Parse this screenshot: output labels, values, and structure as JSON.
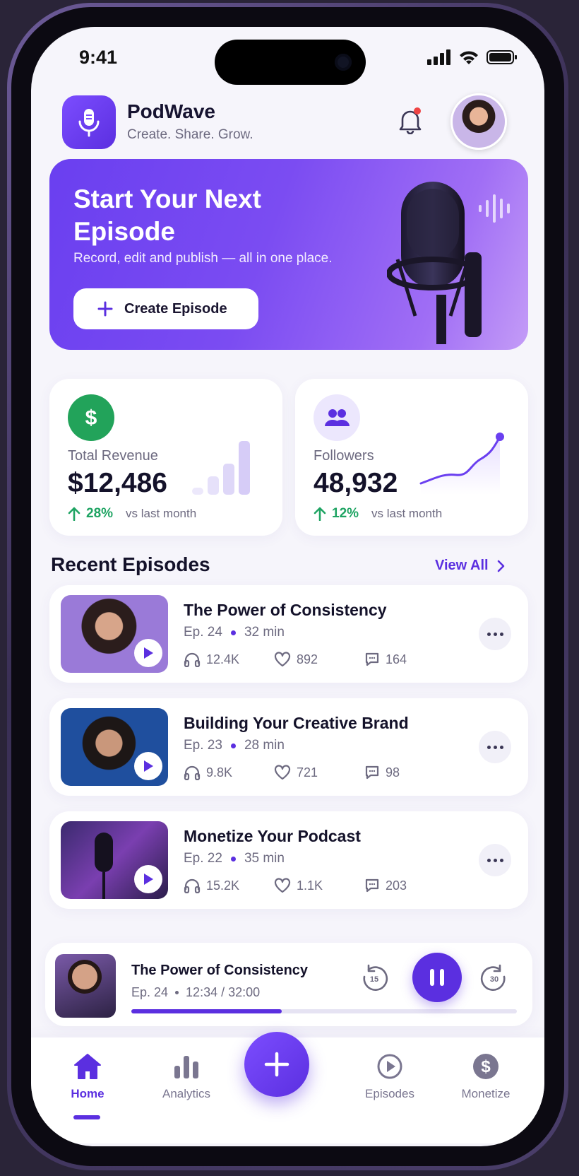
{
  "status": {
    "time": "9:41"
  },
  "app": {
    "name": "PodWave",
    "tagline": "Create. Share. Grow."
  },
  "hero": {
    "title": "Start Your Next Episode",
    "subtitle": "Record, edit and publish — all in one place.",
    "button": "Create Episode"
  },
  "stats": [
    {
      "label": "Total Revenue",
      "value": "$12,486",
      "change": "28%",
      "vs": "vs last month",
      "icon": "dollar-icon",
      "color": "#22a35a"
    },
    {
      "label": "Followers",
      "value": "48,932",
      "change": "12%",
      "vs": "vs last month",
      "icon": "users-icon",
      "color": "#5b2fe0"
    }
  ],
  "recent": {
    "title": "Recent Episodes",
    "view_all": "View All"
  },
  "episodes": [
    {
      "title": "The Power of Consistency",
      "ep": "Ep. 24",
      "duration": "32 min",
      "listens": "12.4K",
      "likes": "892",
      "comments": "164"
    },
    {
      "title": "Building Your Creative Brand",
      "ep": "Ep. 23",
      "duration": "28 min",
      "listens": "9.8K",
      "likes": "721",
      "comments": "98"
    },
    {
      "title": "Monetize Your Podcast",
      "ep": "Ep. 22",
      "duration": "35 min",
      "listens": "15.2K",
      "likes": "1.1K",
      "comments": "203"
    }
  ],
  "player": {
    "title": "The Power of Consistency",
    "ep": "Ep. 24",
    "time": "12:34 / 32:00",
    "progress": 0.39,
    "skip_back": "15",
    "skip_fwd": "30"
  },
  "nav": {
    "home": "Home",
    "analytics": "Analytics",
    "episodes": "Episodes",
    "monetize": "Monetize"
  },
  "colors": {
    "accent": "#5b2fe0",
    "positive": "#1fa463"
  }
}
